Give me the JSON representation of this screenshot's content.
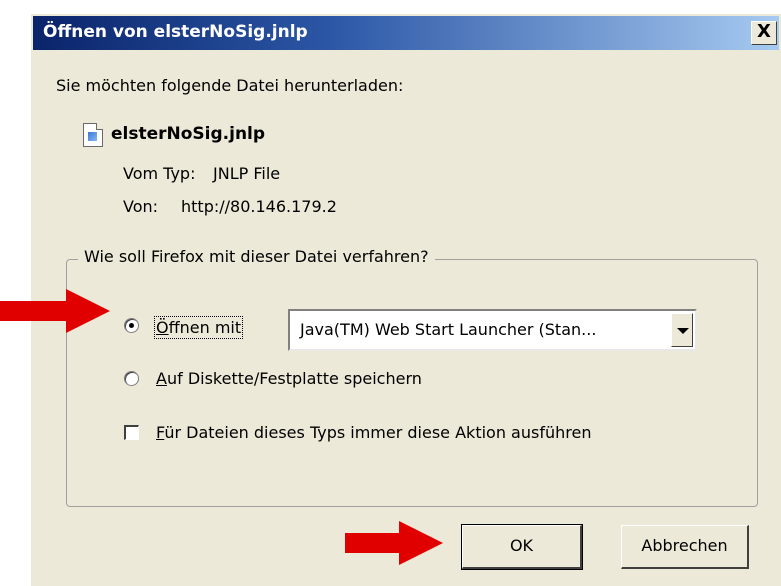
{
  "window": {
    "title": "Öffnen von elsterNoSig.jnlp",
    "close_glyph": "X"
  },
  "prompt": "Sie möchten folgende Datei herunterladen:",
  "file": {
    "name": "elsterNoSig.jnlp",
    "type_label": "Vom Typ:",
    "type_value": "JNLP File",
    "from_label": "Von:",
    "from_value": "http://80.146.179.2"
  },
  "action_group": {
    "legend": "Wie soll Firefox mit dieser Datei verfahren?",
    "open_with": {
      "label_first": "Ö",
      "label_rest": "ffnen mit",
      "selected": true
    },
    "open_with_app": {
      "value": "Java(TM) Web Start Launcher (Stan..."
    },
    "save": {
      "label_first": "A",
      "label_rest": "uf Diskette/Festplatte speichern",
      "selected": false
    },
    "always": {
      "label_first": "F",
      "label_rest": "ür Dateien dieses Typs immer diese Aktion ausführen",
      "checked": false
    }
  },
  "buttons": {
    "ok": "OK",
    "cancel": "Abbrechen"
  },
  "colors": {
    "title_start": "#0a246a",
    "title_end": "#a6caf0",
    "dialog_bg": "#ece9d8",
    "annotation_arrow": "#e00000"
  },
  "icons": {
    "file": "jnlp-file-icon",
    "annotation": "red-arrow-icon"
  }
}
